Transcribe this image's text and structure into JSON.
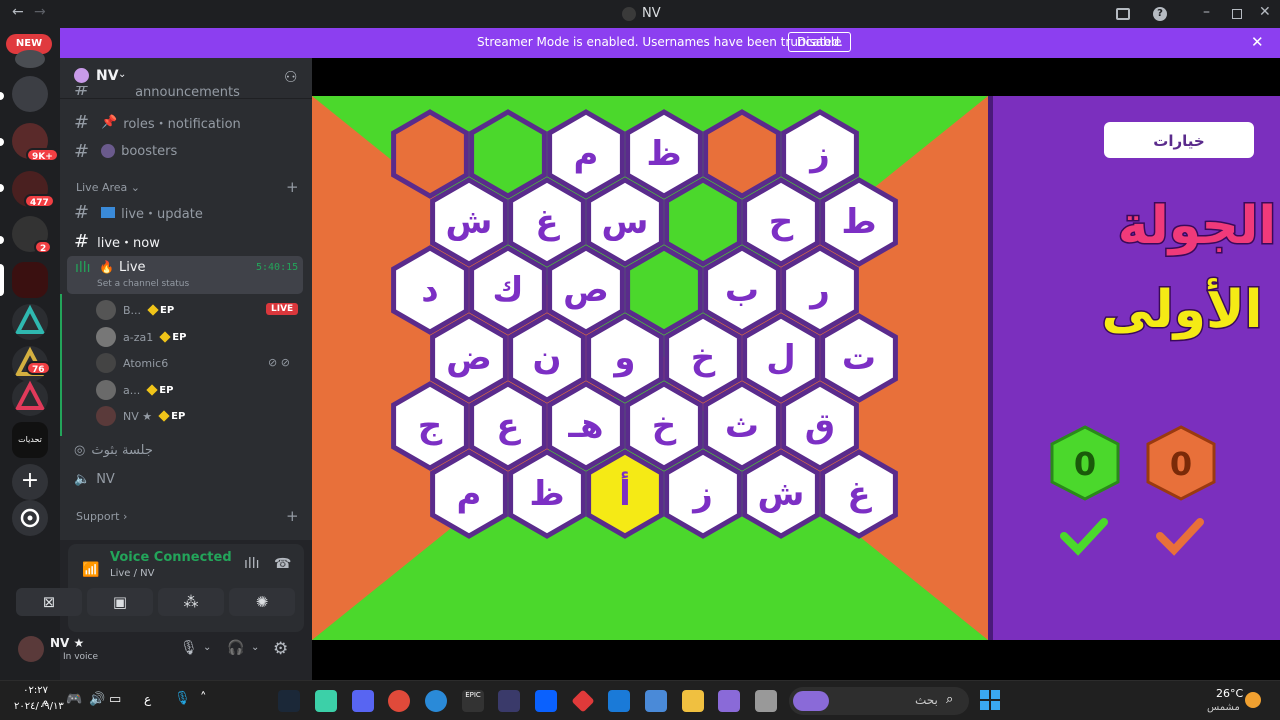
{
  "titlebar": {
    "title": "NV"
  },
  "servers": {
    "new_label": "NEW",
    "badges": [
      "9K+",
      "477",
      "2",
      "76"
    ],
    "folder_label": "تحديات"
  },
  "banner": {
    "text": "Streamer Mode is enabled. Usernames have been truncated.",
    "button": "Disable"
  },
  "server": {
    "name": "NV"
  },
  "channels": {
    "partial": "announcements",
    "roles": "roles・notification",
    "boosters": "boosters",
    "cat_live": "Live Area",
    "live_update": "live・update",
    "live_now": "live・now",
    "voice_live": {
      "name": "Live",
      "time": "5:40:15",
      "status": "Set a channel status"
    },
    "users": [
      {
        "name": "B...",
        "ep": "EP",
        "live": "LIVE"
      },
      {
        "name": "a-za1",
        "ep": "EP"
      },
      {
        "name": "Atomic6"
      },
      {
        "name": "a...",
        "ep": "EP"
      },
      {
        "name": "NV ★",
        "ep": "EP"
      }
    ],
    "stage_channel": "جلسة بثوث",
    "voice_nv": "NV",
    "cat_support": "Support"
  },
  "voice": {
    "connected": "Voice Connected",
    "channel": "Live / NV"
  },
  "user": {
    "name": "NV ★",
    "status": "In voice"
  },
  "game": {
    "options_label": "خيارات",
    "round_line1": "الجولة",
    "round_line2": "الأولى",
    "score_green": "0",
    "score_orange": "0",
    "board": [
      [
        "",
        "",
        "م",
        "ظ",
        "",
        "ز"
      ],
      [
        "ش",
        "غ",
        "س",
        "",
        "ح",
        "ط"
      ],
      [
        "د",
        "ك",
        "ص",
        "",
        "ب",
        "ر"
      ],
      [
        "ض",
        "ن",
        "و",
        "خ",
        "ل",
        "ت"
      ],
      [
        "ج",
        "ع",
        "هـ",
        "خ",
        "ث",
        "ق"
      ],
      [
        "م",
        "ظ",
        "أ",
        "ز",
        "ش",
        "غ"
      ]
    ],
    "special": {
      "orange": "#e8703a",
      "green": "#4bd82c",
      "yellow": "#f5ea15"
    }
  },
  "taskbar": {
    "time": "٠٢:٢٧ م",
    "date": "٢٠٢٤/٠٩/١٣",
    "lang": "ع",
    "search": "بحث",
    "temp": "26°C",
    "weather": "مشمس"
  }
}
